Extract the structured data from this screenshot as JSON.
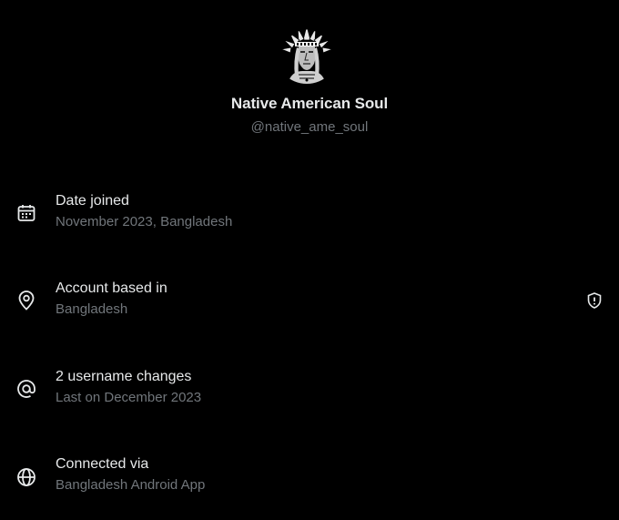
{
  "profile": {
    "avatar_icon": "native-american-headdress-portrait",
    "display_name": "Native American Soul",
    "handle": "@native_ame_soul"
  },
  "info_rows": [
    {
      "icon": "calendar-icon",
      "title": "Date joined",
      "subtitle": "November 2023, Bangladesh"
    },
    {
      "icon": "location-pin-icon",
      "title": "Account based in",
      "subtitle": "Bangladesh",
      "trailing_icon": "shield-icon"
    },
    {
      "icon": "at-sign-icon",
      "title": "2 username changes",
      "subtitle": "Last on December 2023"
    },
    {
      "icon": "globe-icon",
      "title": "Connected via",
      "subtitle": "Bangladesh Android App"
    }
  ],
  "colors": {
    "background": "#000000",
    "primary_text": "#e7e9ea",
    "secondary_text": "#71767b"
  }
}
